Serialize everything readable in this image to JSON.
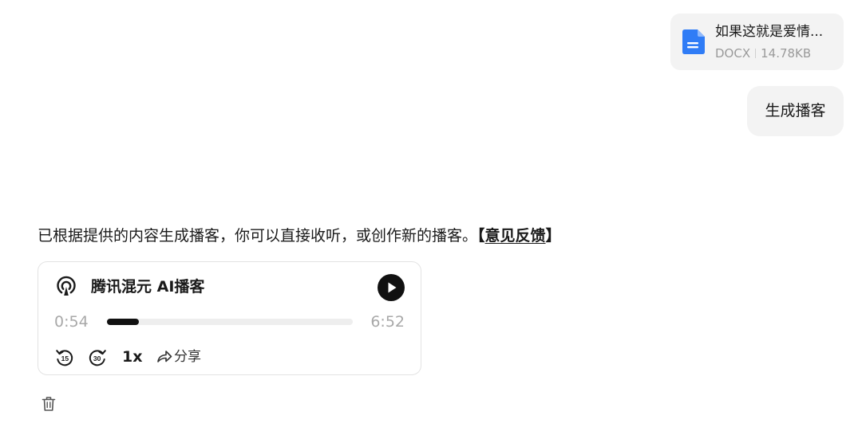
{
  "attachment": {
    "file_name": "如果这就是爱情...",
    "file_type": "DOCX",
    "file_size": "14.78KB",
    "icon": "document-icon",
    "icon_color": "#2f7cf6"
  },
  "user_message": {
    "text": "生成播客"
  },
  "assistant_message": {
    "text": "已根据提供的内容生成播客，你可以直接收听，或创作新的播客。",
    "bracket_open": "【",
    "feedback_link": "意见反馈",
    "bracket_close": "】"
  },
  "podcast_player": {
    "icon": "podcast-icon",
    "title": "腾讯混元 AI播客",
    "current_time": "0:54",
    "total_time": "6:52",
    "progress_fraction": 0.131,
    "rewind_label": "15",
    "forward_label": "30",
    "speed_label": "1x",
    "share_label": "分享"
  },
  "actions": {
    "delete_icon": "trash-icon"
  }
}
